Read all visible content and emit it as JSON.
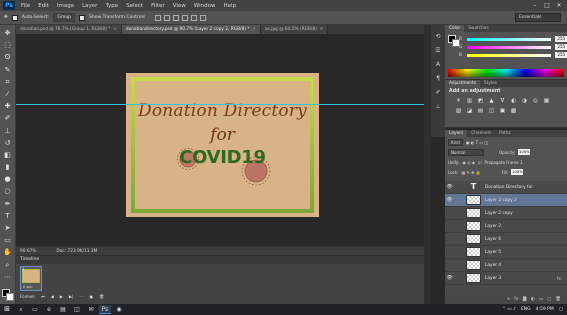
{
  "app": {
    "logo": "Ps"
  },
  "menu": [
    "File",
    "Edit",
    "Image",
    "Layer",
    "Type",
    "Select",
    "Filter",
    "View",
    "Window",
    "Help"
  ],
  "window_controls": [
    "–",
    "□",
    "✕"
  ],
  "options": {
    "auto_select_label": "Auto-Select:",
    "auto_select_value": "Group",
    "show_transform_label": "Show Transform Controls",
    "workspace": "Essentials"
  },
  "tabs": [
    {
      "label": "donation.psd @ 76.7% (Group 1, RGB/8) *",
      "active": false
    },
    {
      "label": "donationdirectory.psd @ 90.7% (Layer 2 copy 2, RGB/8) *",
      "active": true
    },
    {
      "label": "as.jpg @ 64.5% (RGB/8)",
      "active": false
    }
  ],
  "canvas": {
    "title_line": "Donation Directory",
    "for_line": "for",
    "covid_line": "COVID19"
  },
  "status": {
    "zoom": "90.67%",
    "doc": "Doc: 723.9K/11.3M"
  },
  "timeline": {
    "header": "Timeline",
    "frame_number": "1",
    "frame_duration": "0 sec.",
    "loop": "Forever"
  },
  "color_panel": {
    "tabs": [
      "Color",
      "Swatches"
    ],
    "sliders": [
      {
        "label": "R",
        "value": "255",
        "color": "#ff3b3b"
      },
      {
        "label": "G",
        "value": "255",
        "color": "#3bff3b"
      },
      {
        "label": "B",
        "value": "255",
        "color": "#3b3bff"
      }
    ]
  },
  "adjustments_panel": {
    "tabs": [
      "Adjustments",
      "Styles"
    ],
    "add_label": "Add an adjustment",
    "icons": [
      "☀",
      "▥",
      "◩",
      "▲",
      "∇",
      "◐",
      "◑",
      "◎",
      "▦",
      "▧",
      "◪",
      "▤",
      "◫",
      "▣",
      "▩"
    ]
  },
  "layers_panel": {
    "tabs": [
      "Layers",
      "Channels",
      "Paths"
    ],
    "kind": "Kind",
    "blend": "Normal",
    "opacity_label": "Opacity:",
    "opacity_value": "100%",
    "unify_label": "Unify:",
    "propagate_label": "Propagate Frame 1",
    "lock_label": "Lock:",
    "fill_label": "Fill:",
    "fill_value": "100%",
    "layers": [
      {
        "name": "Donation Directory for",
        "type": "text",
        "visible": true,
        "selected": false
      },
      {
        "name": "Layer 2 copy 2",
        "type": "pixel",
        "visible": true,
        "selected": true
      },
      {
        "name": "Layer 2 copy",
        "type": "pixel",
        "visible": false,
        "selected": false
      },
      {
        "name": "Layer 2",
        "type": "pixel",
        "visible": false,
        "selected": false
      },
      {
        "name": "Layer 6",
        "type": "pixel",
        "visible": false,
        "selected": false
      },
      {
        "name": "Layer 5",
        "type": "pixel",
        "visible": false,
        "selected": false
      },
      {
        "name": "Layer 4",
        "type": "pixel",
        "visible": false,
        "selected": false
      },
      {
        "name": "Layer 3",
        "type": "pixel",
        "visible": true,
        "selected": false
      }
    ],
    "footer_icons": [
      "∞",
      "fx",
      "◙",
      "◐",
      "▭",
      "▢",
      "🗑"
    ]
  },
  "taskbar": {
    "tray": {
      "lang": "ENG",
      "time": "4:59 PM"
    }
  },
  "colors": {
    "accent": "#36c5d6",
    "doc_bg": "#d7b386",
    "title_brown": "#7a3b16",
    "covid_green": "#2d6a1f",
    "frame_green": "#a9c23f"
  }
}
